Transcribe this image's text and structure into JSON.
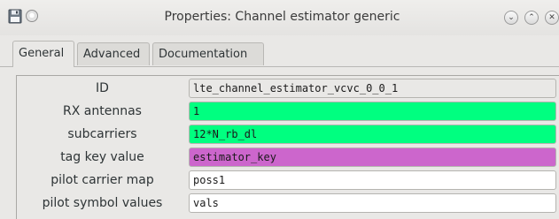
{
  "window": {
    "title": "Properties: Channel estimator generic",
    "icon": "save-floppy-icon",
    "pin_icon": "pin-circle-icon",
    "minimize_icon": "chevron-down-icon",
    "maximize_icon": "chevron-up-icon",
    "close_icon": "close-icon"
  },
  "tabs": [
    {
      "label": "General",
      "active": true
    },
    {
      "label": "Advanced",
      "active": false
    },
    {
      "label": "Documentation",
      "active": false
    }
  ],
  "colors": {
    "id_bg": "#e9e8e6",
    "int_bg": "#00ff80",
    "complex_bg": "#00ff80",
    "string_bg": "#cc66cc",
    "raw_bg": "#ffffff"
  },
  "params": [
    {
      "label": "ID",
      "value": "lte_channel_estimator_vcvc_0_0_1"
    },
    {
      "label": "RX antennas",
      "value": "1"
    },
    {
      "label": "subcarriers",
      "value": "12*N_rb_dl"
    },
    {
      "label": "tag key value",
      "value": "estimator_key"
    },
    {
      "label": "pilot carrier map",
      "value": "poss1"
    },
    {
      "label": "pilot symbol values",
      "value": "vals"
    }
  ]
}
